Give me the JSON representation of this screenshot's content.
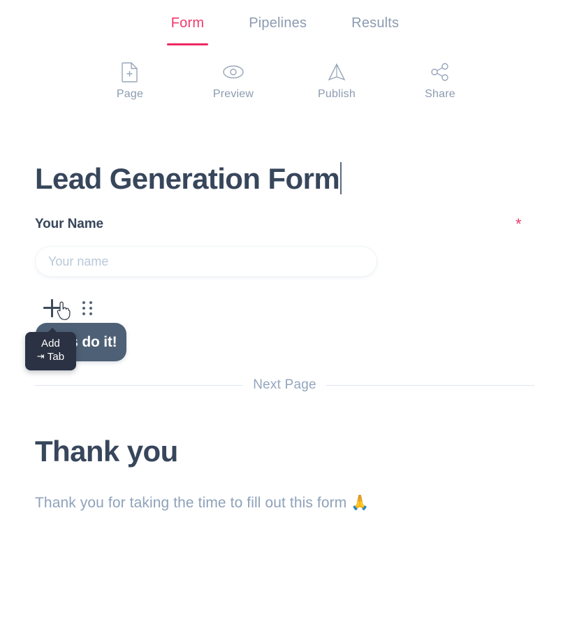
{
  "tabs": [
    {
      "label": "Form",
      "active": true
    },
    {
      "label": "Pipelines",
      "active": false
    },
    {
      "label": "Results",
      "active": false
    }
  ],
  "toolbar": [
    {
      "label": "Page",
      "icon": "page-add-icon"
    },
    {
      "label": "Preview",
      "icon": "eye-icon"
    },
    {
      "label": "Publish",
      "icon": "send-triangle-icon"
    },
    {
      "label": "Share",
      "icon": "share-nodes-icon"
    }
  ],
  "form": {
    "title": "Lead Generation Form",
    "field": {
      "label": "Your Name",
      "placeholder": "Your name",
      "value": "",
      "required_marker": "*"
    },
    "submit_label": "Let's do it!"
  },
  "tooltip": {
    "title": "Add",
    "shortcut_glyph": "⇥",
    "shortcut_label": "Tab"
  },
  "divider": {
    "label": "Next Page"
  },
  "thankyou": {
    "title": "Thank you",
    "body": "Thank you for taking the time to fill out this form",
    "emoji": "🙏"
  },
  "colors": {
    "accent_pink": "#ee2a63",
    "heading": "#37465b",
    "muted": "#8c9bb0",
    "button_bg": "#4e6075",
    "tooltip_bg": "#2b3243",
    "divider_line": "#dde6ef"
  }
}
